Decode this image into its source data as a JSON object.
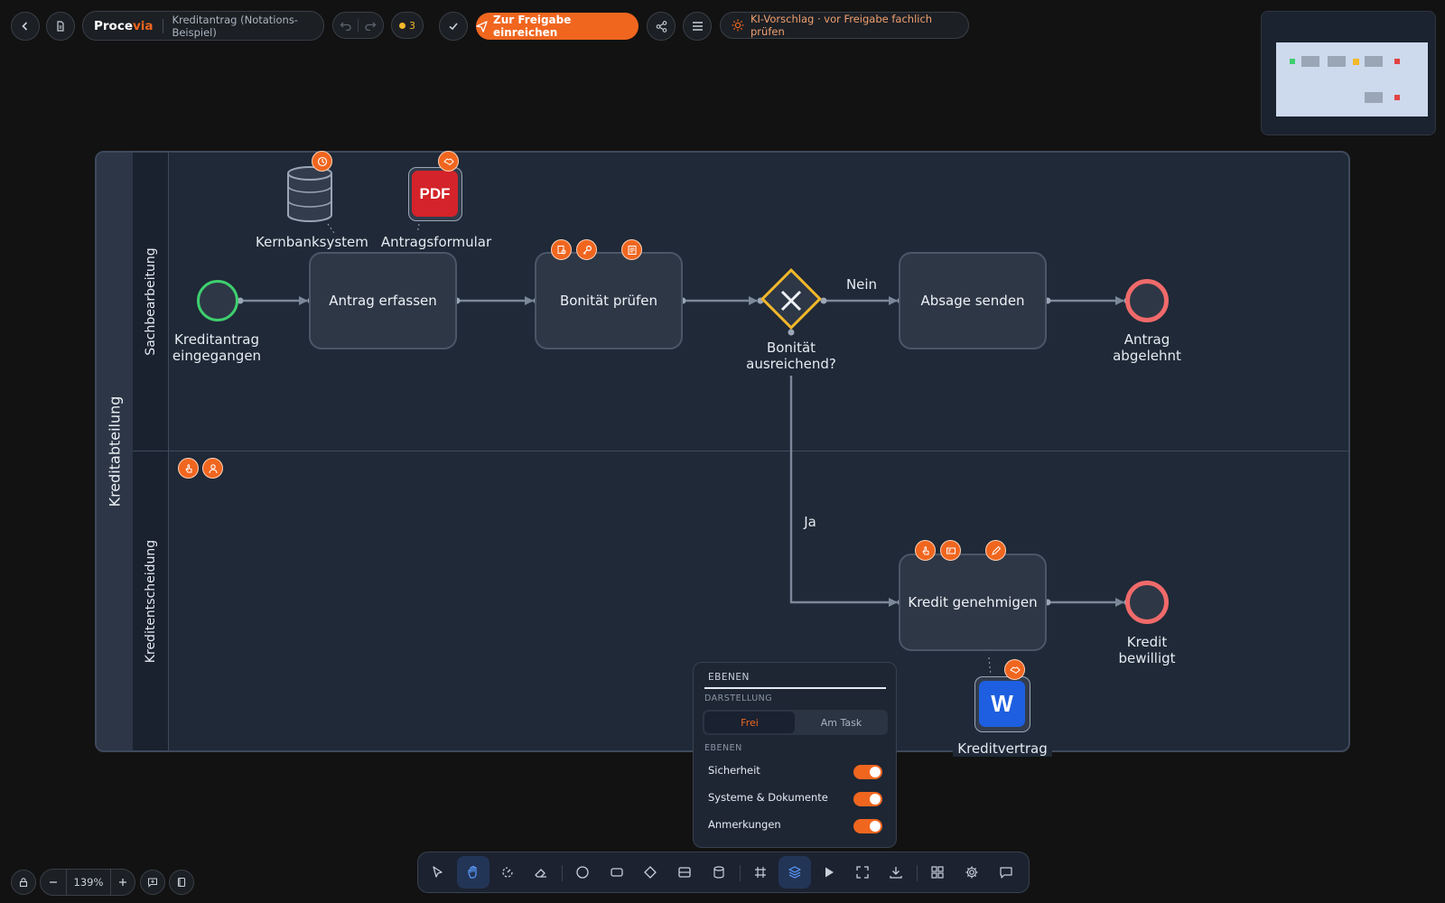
{
  "header": {
    "brand_first": "Proce",
    "brand_second": "via",
    "doc_title": "Kreditantrag (Notations-Beispiel)",
    "comment_count": "3",
    "submit_label": "Zur Freigabe einreichen",
    "ai_hint": "KI-Vorschlag · vor Freigabe fachlich prüfen"
  },
  "diagram": {
    "pool_label": "Kreditabteilung",
    "lanes": [
      "Sachbearbeitung",
      "Kreditentscheidung"
    ],
    "start_event_label_1": "Kreditantrag",
    "start_event_label_2": "eingegangen",
    "tasks": {
      "antrag": "Antrag erfassen",
      "bonitaet": "Bonität prüfen",
      "absage": "Absage senden",
      "kredit": "Kredit genehmigen"
    },
    "gateway_label_1": "Bonität",
    "gateway_label_2": "ausreichend?",
    "flow_no": "Nein",
    "flow_yes": "Ja",
    "end_rejected_1": "Antrag",
    "end_rejected_2": "abgelehnt",
    "end_approved_1": "Kredit",
    "end_approved_2": "bewilligt",
    "artifacts": {
      "kernbank": "Kernbanksystem",
      "antragsformular": "Antragsformular",
      "pdf_text": "PDF",
      "kreditvertrag": "Kreditvertrag",
      "word_text": "W"
    }
  },
  "layers_panel": {
    "title": "EBENEN",
    "section_display": "DARSTELLUNG",
    "mode_free": "Frei",
    "mode_task": "Am Task",
    "section_layers": "EBENEN",
    "layers": [
      "Sicherheit",
      "Systeme & Dokumente",
      "Anmerkungen"
    ]
  },
  "zoom": {
    "value": "139%"
  },
  "colors": {
    "accent": "#f0661f",
    "start_event": "#3ecf6e",
    "end_event": "#f06a6a",
    "gateway": "#f2b82a",
    "canvas_bg": "#1f2937"
  }
}
